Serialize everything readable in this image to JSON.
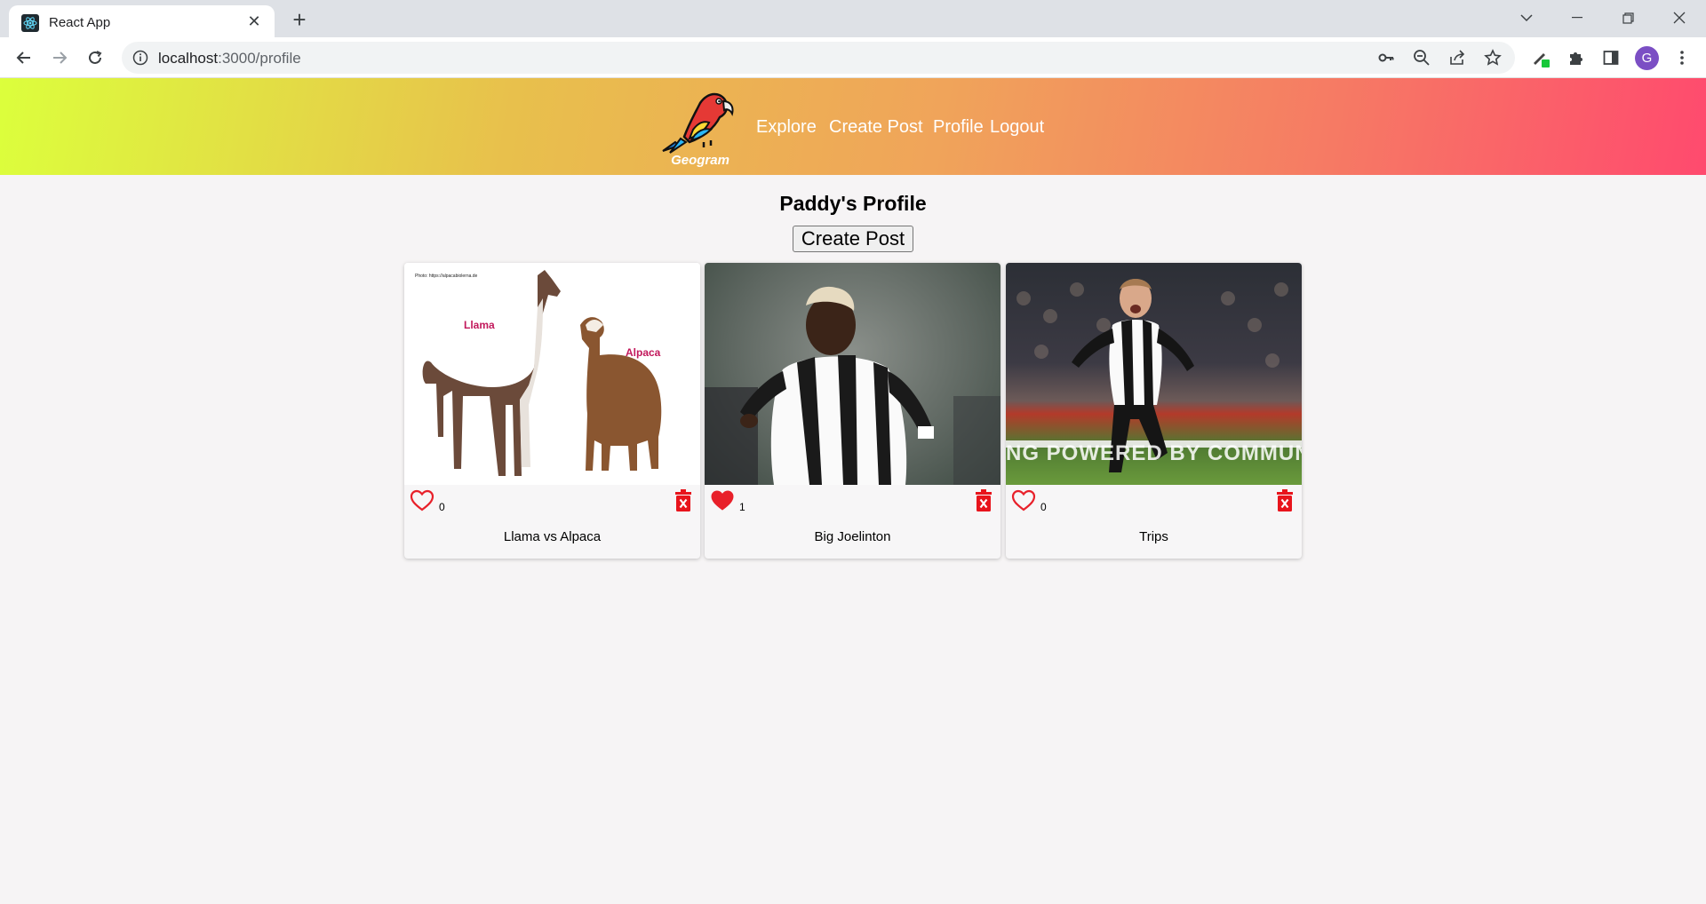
{
  "browser": {
    "tab_title": "React App",
    "url_host": "localhost",
    "url_rest": ":3000/profile",
    "profile_initial": "G"
  },
  "app": {
    "logo_text": "Geogram",
    "nav": [
      "Explore",
      "Create Post",
      "Profile",
      "Logout"
    ]
  },
  "profile": {
    "title": "Paddy's Profile",
    "create_button": "Create Post"
  },
  "posts": [
    {
      "caption": "Llama vs Alpaca",
      "likes": "0",
      "liked": false,
      "image_labels": [
        "Llama",
        "Alpaca"
      ],
      "image_credit": "Photo: https://alpacabiolerna.de"
    },
    {
      "caption": "Big Joelinton",
      "likes": "1",
      "liked": true
    },
    {
      "caption": "Trips",
      "likes": "0",
      "liked": false,
      "image_banner": "NG POWERED BY COMMUNITY"
    }
  ],
  "colors": {
    "like_red": "#e8202a",
    "delete_red": "#e8141c"
  }
}
